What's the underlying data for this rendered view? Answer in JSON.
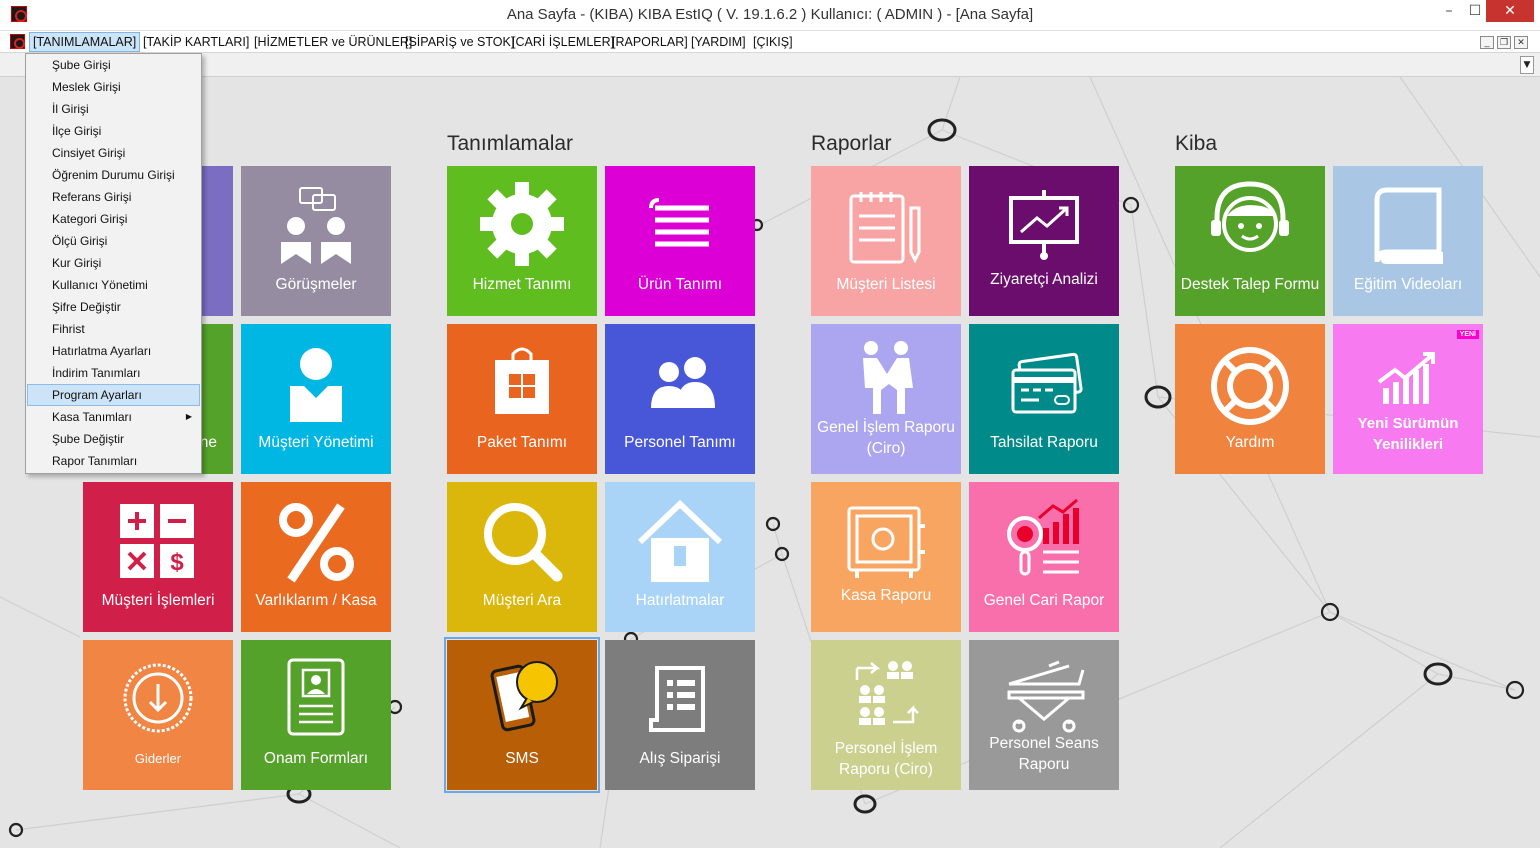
{
  "window": {
    "title": "Ana Sayfa - (KIBA) KIBA EstIQ  ( V. 19.1.6.2 ) Kullanıcı:  ( ADMIN )  - [Ana Sayfa]",
    "minimize": "–",
    "maximize": "☐",
    "close": "✕"
  },
  "menubar": {
    "items": [
      "[TANIMLAMALAR]",
      "[TAKİP KARTLARI]",
      "[HİZMETLER ve ÜRÜNLER]",
      "[SİPARİŞ ve STOK]",
      "[CARİ İŞLEMLER]",
      "[RAPORLAR]",
      "[YARDIM]",
      "[ÇIKIŞ]"
    ],
    "active_index": 0,
    "mdi": {
      "minimize": "_",
      "restore": "❐",
      "close": "✕"
    }
  },
  "dropdown": {
    "items": [
      "Şube Girişi",
      "Meslek Girişi",
      "İl Girişi",
      "İlçe Girişi",
      "Cinsiyet Girişi",
      "Öğrenim Durumu Girişi",
      "Referans Girişi",
      "Kategori Girişi",
      "Ölçü Girişi",
      "Kur Girişi",
      "Kullanıcı Yönetimi",
      "Şifre Değiştir",
      "Fihrist",
      "Hatırlatma Ayarları",
      "İndirim Tanımları",
      "Program Ayarları",
      "Kasa Tanımları",
      "Şube Değiştir",
      "Rapor Tanımları"
    ],
    "highlighted_index": 15,
    "submenu_index": 16,
    "submenu_arrow": "▶"
  },
  "groups": {
    "tanimlamalar": "Tanımlamalar",
    "raporlar": "Raporlar",
    "kiba": "Kiba"
  },
  "tiles": {
    "gorusmeler": {
      "label": "Görüşmeler",
      "color": "#958ca1"
    },
    "musteri_yonetimi": {
      "label": "Müşteri Yönetimi",
      "color": "#00b7e4"
    },
    "partial_purple": {
      "color": "#7b6ec2"
    },
    "partial_green": {
      "label": "ne",
      "color": "#55a22a"
    },
    "musteri_islemleri": {
      "label": "Müşteri İşlemleri",
      "color": "#d0204a"
    },
    "varliklarim": {
      "label": "Varlıklarım / Kasa",
      "color": "#ea6a1f"
    },
    "giderler": {
      "label": "Giderler",
      "color": "#f08544"
    },
    "onam_formlari": {
      "label": "Onam Formları",
      "color": "#55a22a"
    },
    "hizmet_tanimi": {
      "label": "Hizmet Tanımı",
      "color": "#5fbd1f"
    },
    "urun_tanimi": {
      "label": "Ürün Tanımı",
      "color": "#dc00d7"
    },
    "paket_tanimi": {
      "label": "Paket Tanımı",
      "color": "#e9641f"
    },
    "personel_tanimi": {
      "label": "Personel Tanımı",
      "color": "#4757d8"
    },
    "musteri_ara": {
      "label": "Müşteri Ara",
      "color": "#dcb70b"
    },
    "hatirlatmalar": {
      "label": "Hatırlatmalar",
      "color": "#a9d4f8"
    },
    "sms": {
      "label": "SMS",
      "color": "#b75e07"
    },
    "alis_siparisi": {
      "label": "Alış Siparişi",
      "color": "#7d7d7d"
    },
    "musteri_listesi": {
      "label": "Müşteri Listesi",
      "color": "#f8a4a4"
    },
    "ziyaretci_analizi": {
      "label": "Ziyaretçi Analizi",
      "color": "#6b0d6d"
    },
    "genel_islem_raporu": {
      "label": "Genel İşlem Raporu (Ciro)",
      "color": "#aba6ef"
    },
    "tahsilat_raporu": {
      "label": "Tahsilat Raporu",
      "color": "#008a8a"
    },
    "kasa_raporu": {
      "label": "Kasa Raporu",
      "color": "#f9a562"
    },
    "genel_cari_rapor": {
      "label": "Genel Cari Rapor",
      "color": "#f96fac"
    },
    "personel_islem_raporu": {
      "label": "Personel İşlem Raporu (Ciro)",
      "color": "#cbd08f"
    },
    "personel_seans_raporu": {
      "label": "Personel Seans Raporu",
      "color": "#999999"
    },
    "destek_talep_formu": {
      "label": "Destek Talep Formu",
      "color": "#55a22a"
    },
    "egitim_videolari": {
      "label": "Eğitim Videoları",
      "color": "#a9c7e5"
    },
    "yardim": {
      "label": "Yardım",
      "color": "#f0843e"
    },
    "yeni_surumun": {
      "label": "Yeni Sürümün Yenilikleri",
      "color": "#f77af0",
      "badge": "YENİ"
    }
  }
}
